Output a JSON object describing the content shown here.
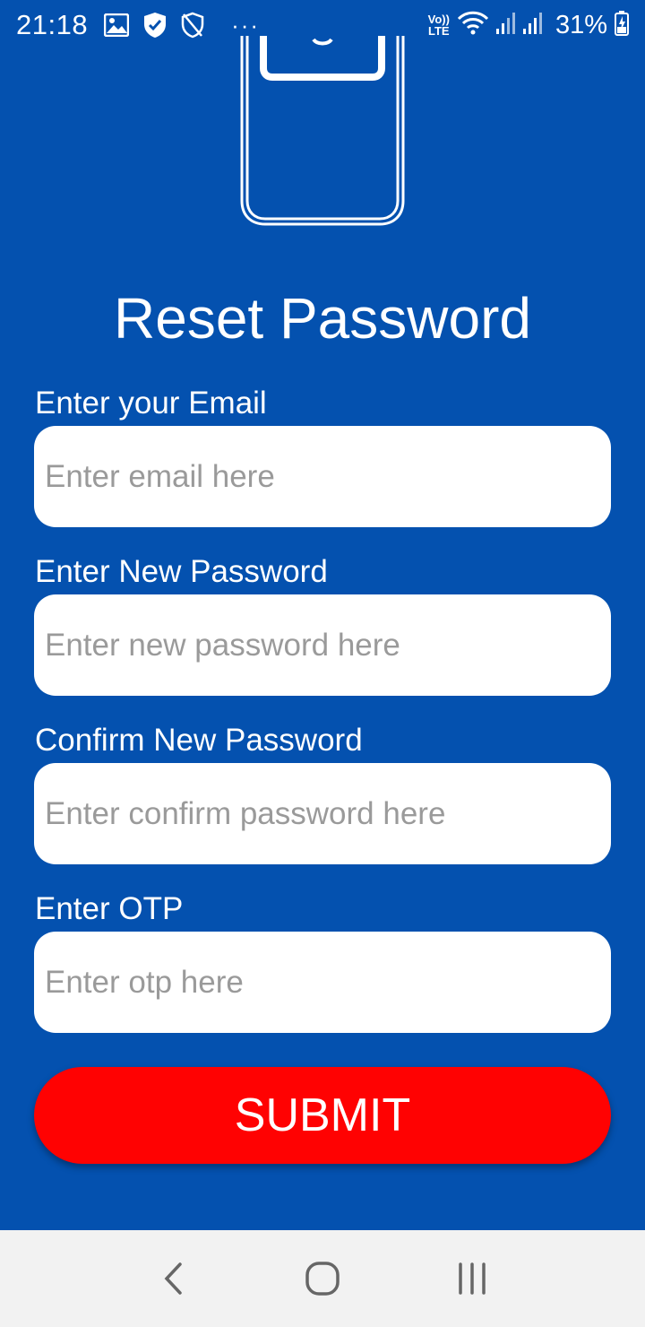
{
  "status_bar": {
    "time": "21:18",
    "volte_line1": "Vo))",
    "volte_line2": "LTE",
    "battery_percent": "31%"
  },
  "colors": {
    "background": "#0451AF",
    "submit": "#FF0202",
    "input_bg": "#FFFFFF",
    "placeholder": "#9A9A9A",
    "nav_bar": "#F2F2F2"
  },
  "page": {
    "title": "Reset Password"
  },
  "form": {
    "email": {
      "label": "Enter your Email",
      "placeholder": "Enter email here",
      "value": ""
    },
    "new_password": {
      "label": "Enter New Password",
      "placeholder": "Enter new password here",
      "value": ""
    },
    "confirm_password": {
      "label": "Confirm New Password",
      "placeholder": "Enter confirm password here",
      "value": ""
    },
    "otp": {
      "label": "Enter OTP",
      "placeholder": "Enter otp here",
      "value": ""
    },
    "submit_label": "SUBMIT"
  },
  "icons": {
    "status": [
      "gallery-icon",
      "shield-check-icon",
      "shield-off-icon",
      "more-dots-icon",
      "volte-icon",
      "wifi-icon",
      "signal-icon",
      "battery-charging-icon"
    ],
    "illustration": "phone-icon",
    "nav": [
      "back-icon",
      "home-icon",
      "recents-icon"
    ]
  }
}
